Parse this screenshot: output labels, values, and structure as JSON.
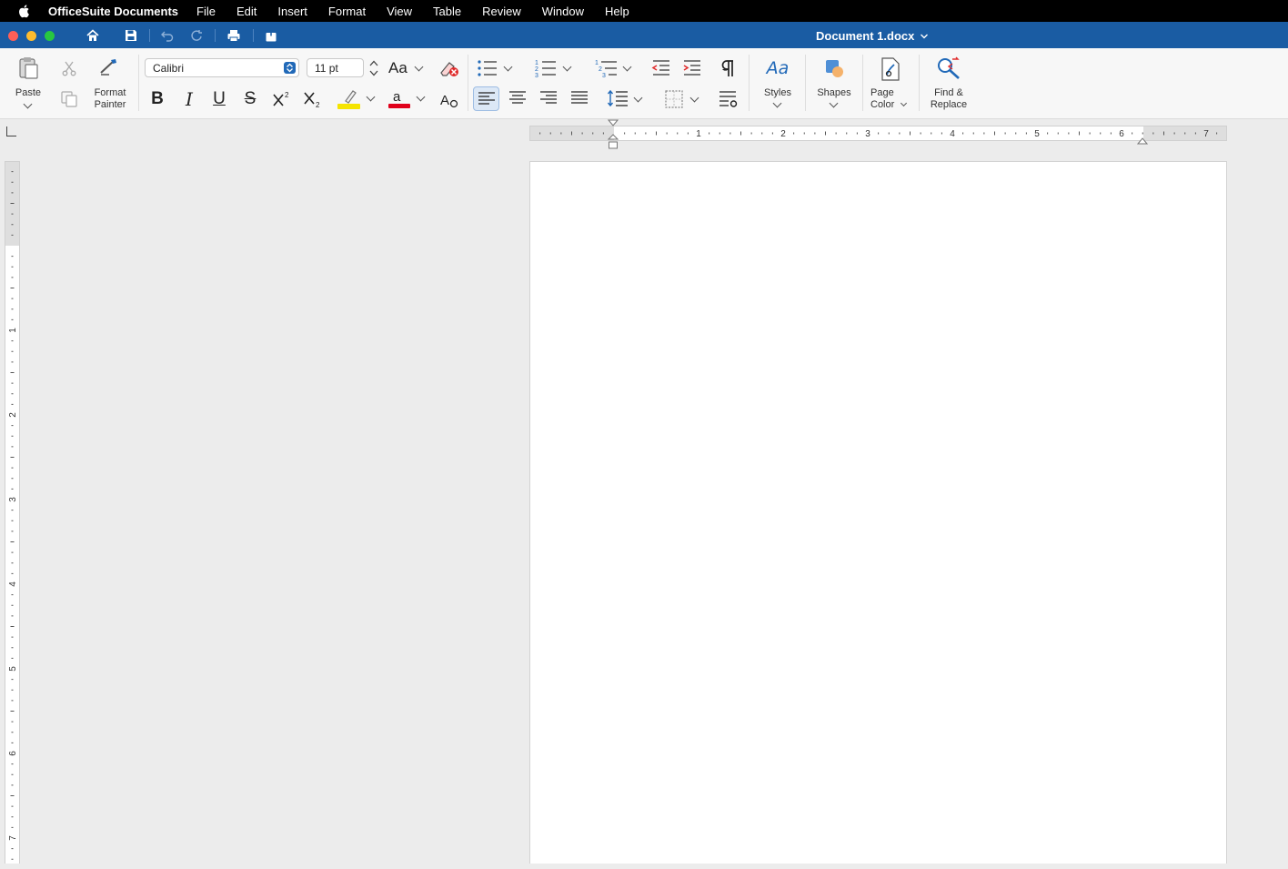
{
  "menubar": {
    "app_name": "OfficeSuite Documents",
    "items": [
      "File",
      "Edit",
      "Insert",
      "Format",
      "View",
      "Table",
      "Review",
      "Window",
      "Help"
    ]
  },
  "titlebar": {
    "document_title": "Document 1.docx"
  },
  "ribbon": {
    "paste_label": "Paste",
    "format_painter_label": "Format\nPainter",
    "font_name": "Calibri",
    "font_size": "11 pt",
    "change_case_label": "Aa",
    "bold": "B",
    "italic": "I",
    "underline": "U",
    "strike": "S",
    "styles_label": "Styles",
    "shapes_label": "Shapes",
    "page_color_label": "Page\nColor",
    "find_replace_label": "Find &\nReplace",
    "highlight_color": "#f5e400",
    "font_color": "#e0001b"
  },
  "rulers": {
    "horizontal_numbers": [
      "1",
      "2",
      "3",
      "4",
      "5",
      "6",
      "7"
    ],
    "vertical_numbers": [
      "1",
      "2",
      "3",
      "4",
      "5",
      "6",
      "7"
    ]
  },
  "colors": {
    "title_bar": "#1a5ca3",
    "accent_icon": "#2169b8",
    "close": "#ff5f57",
    "minimize": "#febc2e",
    "zoom": "#28c840"
  }
}
